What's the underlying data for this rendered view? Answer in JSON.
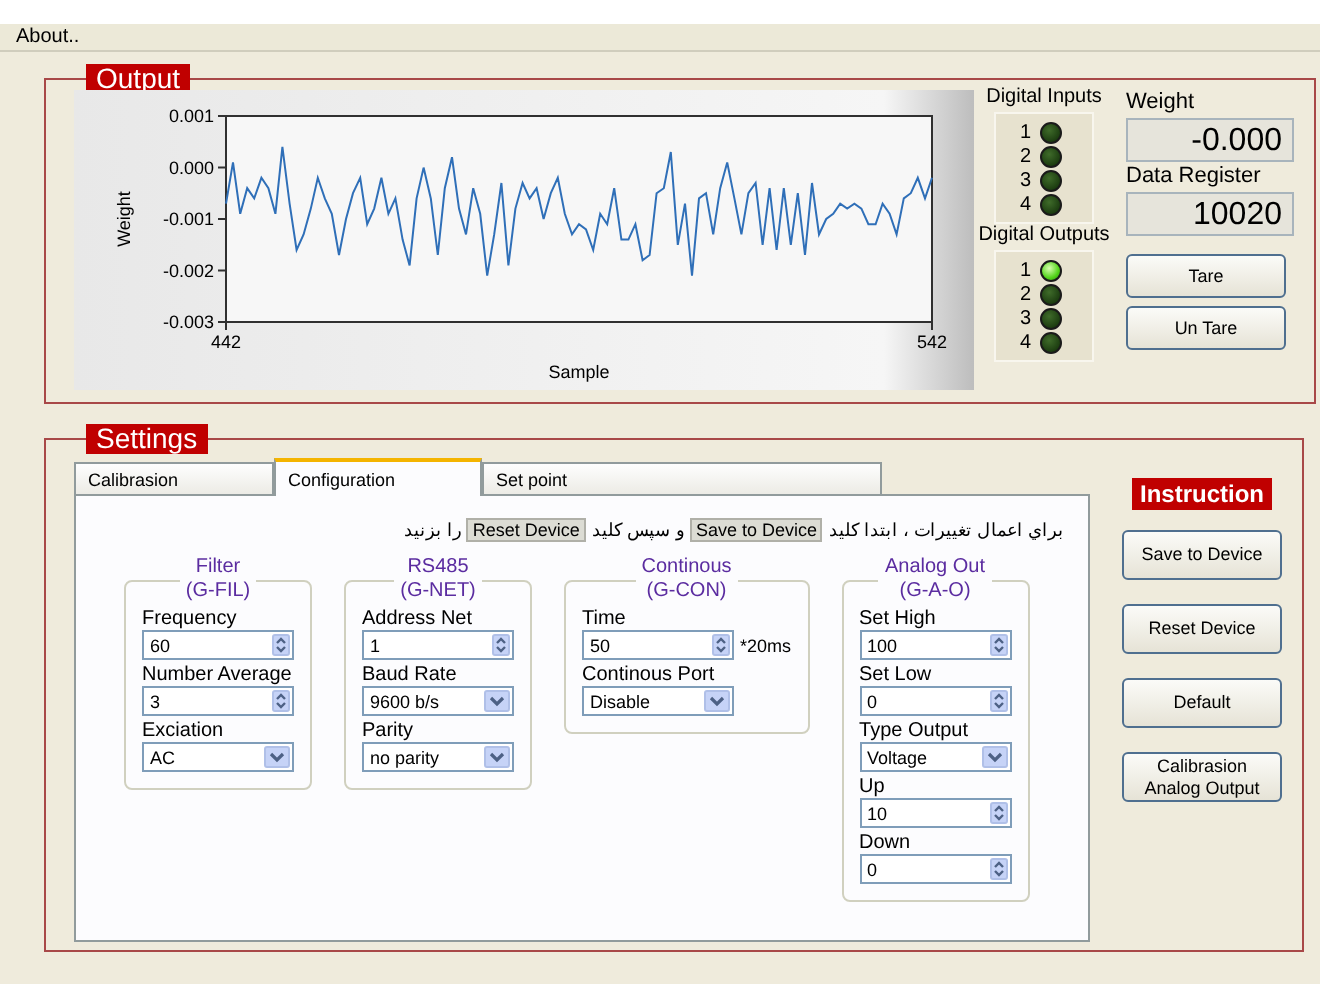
{
  "menu": [
    {
      "label": "About.."
    }
  ],
  "output": {
    "title": "Output",
    "chart_data": {
      "type": "line",
      "xlabel": "Sample",
      "ylabel": "Weight",
      "x": [
        442,
        443,
        444,
        445,
        446,
        447,
        448,
        449,
        450,
        451,
        452,
        453,
        454,
        455,
        456,
        457,
        458,
        459,
        460,
        461,
        462,
        463,
        464,
        465,
        466,
        467,
        468,
        469,
        470,
        471,
        472,
        473,
        474,
        475,
        476,
        477,
        478,
        479,
        480,
        481,
        482,
        483,
        484,
        485,
        486,
        487,
        488,
        489,
        490,
        491,
        492,
        493,
        494,
        495,
        496,
        497,
        498,
        499,
        500,
        501,
        502,
        503,
        504,
        505,
        506,
        507,
        508,
        509,
        510,
        511,
        512,
        513,
        514,
        515,
        516,
        517,
        518,
        519,
        520,
        521,
        522,
        523,
        524,
        525,
        526,
        527,
        528,
        529,
        530,
        531,
        532,
        533,
        534,
        535,
        536,
        537,
        538,
        539,
        540,
        541,
        542
      ],
      "xlim": [
        442,
        542
      ],
      "ylim": [
        -0.003,
        0.001
      ],
      "xticks": [
        {
          "value": 442,
          "label": "442"
        },
        {
          "value": 542,
          "label": "542"
        }
      ],
      "yticks": [
        {
          "value": 0.001,
          "label": "0.001"
        },
        {
          "value": 0,
          "label": "0.000"
        },
        {
          "value": -0.001,
          "label": "-0.001"
        },
        {
          "value": -0.002,
          "label": "-0.002"
        },
        {
          "value": -0.003,
          "label": "-0.003"
        }
      ],
      "series": [
        {
          "color": "#2f6fb8",
          "values": [
            -0.0007,
            0.0001,
            -0.0009,
            -0.0004,
            -0.0006,
            -0.0002,
            -0.0004,
            -0.0009,
            0.0004,
            -0.0007,
            -0.0016,
            -0.0013,
            -0.0008,
            -0.0002,
            -0.0006,
            -0.0009,
            -0.0017,
            -0.001,
            -0.0005,
            -0.0002,
            -0.0011,
            -0.0008,
            -0.0002,
            -0.0009,
            -0.0006,
            -0.0014,
            -0.0019,
            -0.0006,
            0.0,
            -0.0006,
            -0.0017,
            -0.0004,
            0.0002,
            -0.0008,
            -0.0013,
            -0.0004,
            -0.0009,
            -0.0021,
            -0.0013,
            -0.0003,
            -0.0019,
            -0.0008,
            -0.0003,
            -0.0006,
            -0.0004,
            -0.001,
            -0.0005,
            -0.0002,
            -0.0009,
            -0.0013,
            -0.0011,
            -0.0012,
            -0.0016,
            -0.0009,
            -0.0011,
            -0.0004,
            -0.0014,
            -0.0014,
            -0.0011,
            -0.0018,
            -0.0017,
            -0.0005,
            -0.0004,
            0.0003,
            -0.0015,
            -0.0007,
            -0.0021,
            -0.0006,
            -0.0005,
            -0.0013,
            -0.0004,
            0.0001,
            -0.0006,
            -0.0013,
            -0.0005,
            -0.0003,
            -0.0015,
            -0.0004,
            -0.0016,
            -0.0004,
            -0.0015,
            -0.0005,
            -0.0017,
            -0.0003,
            -0.0013,
            -0.001,
            -0.0009,
            -0.0007,
            -0.0008,
            -0.0007,
            -0.0008,
            -0.0011,
            -0.0011,
            -0.0007,
            -0.0009,
            -0.0013,
            -0.0006,
            -0.0005,
            -0.0002,
            -0.0006,
            -0.0002
          ]
        }
      ]
    },
    "digital_inputs": {
      "title": "Digital Inputs",
      "items": [
        {
          "label": "1",
          "on": false
        },
        {
          "label": "2",
          "on": false
        },
        {
          "label": "3",
          "on": false
        },
        {
          "label": "4",
          "on": false
        }
      ]
    },
    "digital_outputs": {
      "title": "Digital Outputs",
      "items": [
        {
          "label": "1",
          "on": true
        },
        {
          "label": "2",
          "on": false
        },
        {
          "label": "3",
          "on": false
        },
        {
          "label": "4",
          "on": false
        }
      ]
    },
    "readouts": [
      {
        "label": "Weight",
        "value": "-0.000"
      },
      {
        "label": "Data Register",
        "value": "10020"
      }
    ],
    "buttons": [
      "Tare",
      "Un Tare"
    ]
  },
  "settings": {
    "title": "Settings",
    "tabs": [
      {
        "label": "Calibrasion",
        "selected": false
      },
      {
        "label": "Configuration",
        "selected": true
      },
      {
        "label": "Set point",
        "selected": false
      }
    ],
    "instruction": [
      {
        "kind": "text",
        "text": "براي اعمال تغييرات ، ابتدا كليد"
      },
      {
        "kind": "key",
        "text": "Save to Device"
      },
      {
        "kind": "text",
        "text": "و سپس كليد"
      },
      {
        "kind": "key",
        "text": "Reset Device"
      },
      {
        "kind": "text",
        "text": "را بزنيد"
      }
    ],
    "groups": [
      {
        "title": "Filter",
        "code": "(G-FIL)",
        "fields": [
          {
            "label": "Frequency",
            "value": "60",
            "kind": "numeric"
          },
          {
            "label": "Number Average",
            "value": "3",
            "kind": "numeric"
          },
          {
            "label": "Exciation",
            "value": "AC",
            "kind": "dropdown"
          }
        ]
      },
      {
        "title": "RS485",
        "code": "(G-NET)",
        "fields": [
          {
            "label": "Address Net",
            "value": "1",
            "kind": "numeric"
          },
          {
            "label": "Baud Rate",
            "value": "9600 b/s",
            "kind": "dropdown"
          },
          {
            "label": "Parity",
            "value": "no parity",
            "kind": "dropdown"
          }
        ]
      },
      {
        "title": "Continous",
        "code": "(G-CON)",
        "fields": [
          {
            "label": "Time",
            "value": "50",
            "kind": "numeric",
            "unit": "*20ms"
          },
          {
            "label": "Continous Port",
            "value": "Disable",
            "kind": "dropdown"
          }
        ]
      },
      {
        "title": "Analog Out",
        "code": "(G-A-O)",
        "fields": [
          {
            "label": "Set High",
            "value": "100",
            "kind": "numeric"
          },
          {
            "label": "Set Low",
            "value": "0",
            "kind": "numeric"
          },
          {
            "label": "Type Output",
            "value": "Voltage",
            "kind": "dropdown"
          },
          {
            "label": "Up",
            "value": "10",
            "kind": "numeric"
          },
          {
            "label": "Down",
            "value": "0",
            "kind": "numeric"
          }
        ]
      }
    ],
    "instruction_title": "Instruction",
    "side_buttons": [
      "Save to Device",
      "Reset Device",
      "Default",
      "Calibrasion\nAnalog Output"
    ]
  }
}
